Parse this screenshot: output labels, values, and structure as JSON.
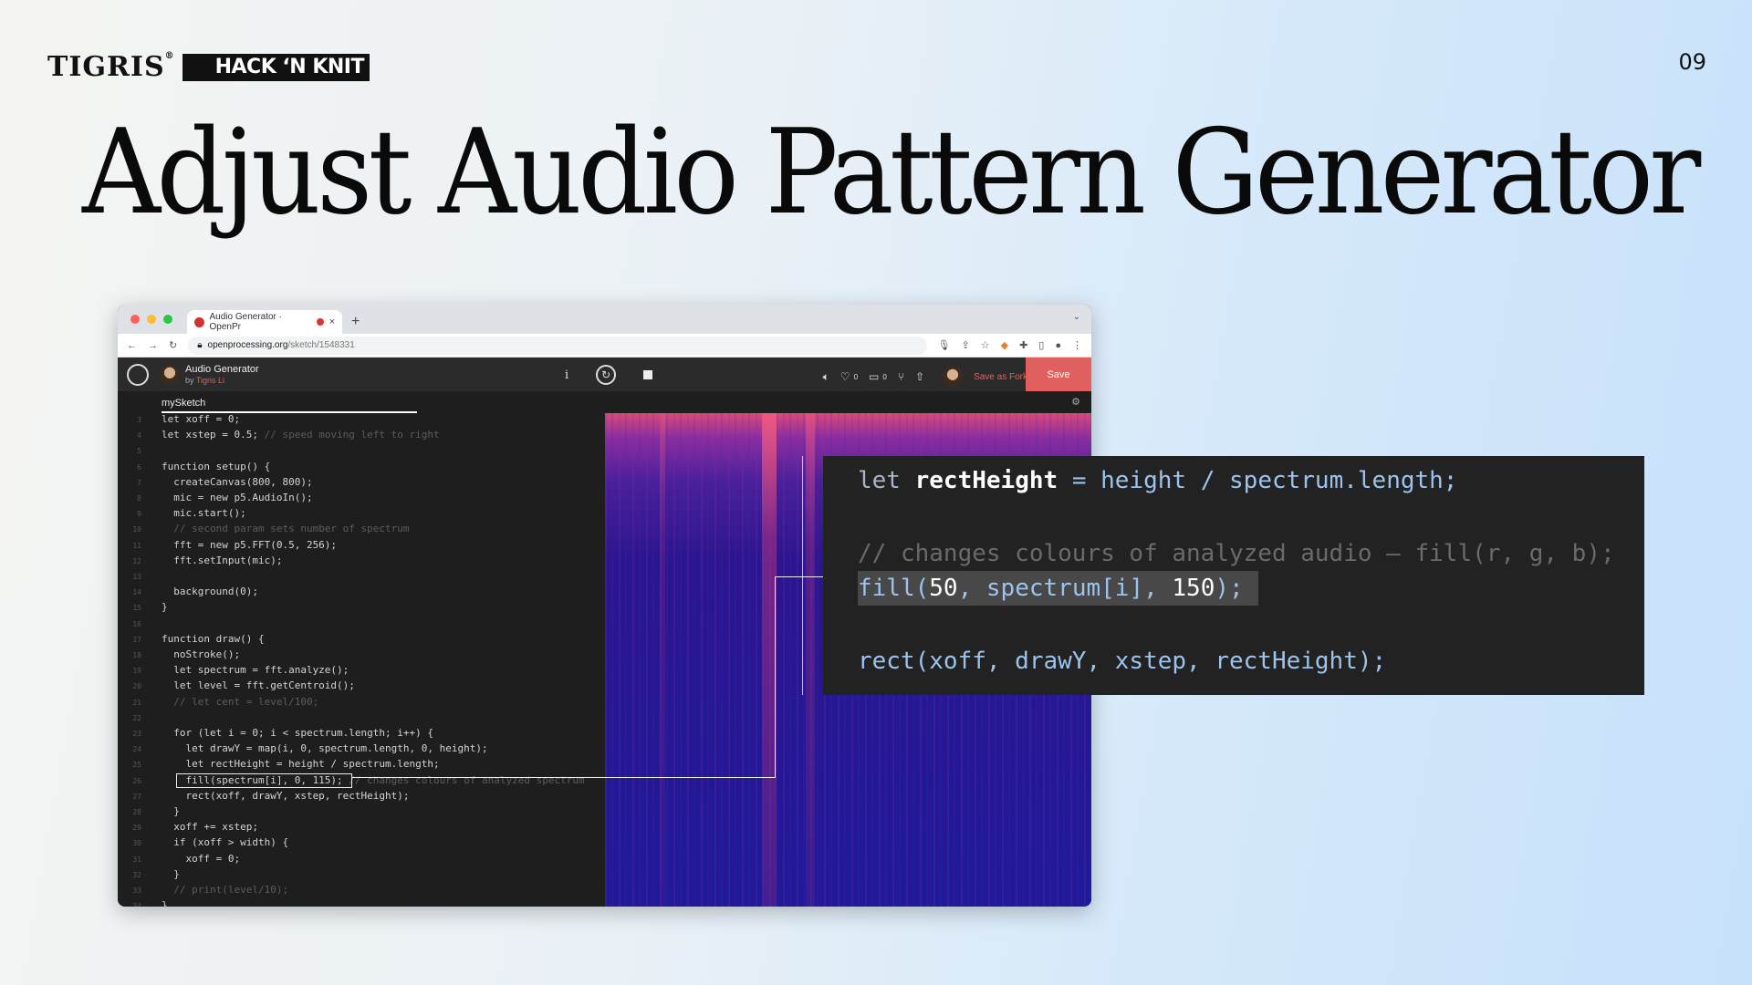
{
  "header": {
    "brand": "TIGRIS",
    "brand_mark": "®",
    "event": "HACK ‘N KNIT",
    "page_number": "09",
    "title": "Adjust Audio Pattern Generator"
  },
  "browser": {
    "tab_title": "Audio Generator · OpenPr",
    "tab_close": "×",
    "new_tab": "+",
    "url_domain": "openprocessing.org",
    "url_path": "/sketch/1548331",
    "sketch_title": "Audio Generator",
    "by_prefix": "by",
    "author": "Tigris Li",
    "likes": "0",
    "comments": "0",
    "save_fork_label": "Save as Fork",
    "save_label": "Save",
    "file_tab": "mySketch"
  },
  "code": [
    {
      "n": "3",
      "t": "let xoff = 0;",
      "c": ""
    },
    {
      "n": "4",
      "t": "let xstep = 0.5; ",
      "c": "// speed moving left to right"
    },
    {
      "n": "5",
      "t": "",
      "c": ""
    },
    {
      "n": "6",
      "t": "function setup() {",
      "c": ""
    },
    {
      "n": "7",
      "t": "  createCanvas(800, 800);",
      "c": ""
    },
    {
      "n": "8",
      "t": "  mic = new p5.AudioIn();",
      "c": ""
    },
    {
      "n": "9",
      "t": "  mic.start();",
      "c": ""
    },
    {
      "n": "10",
      "t": "  ",
      "c": "// second param sets number of spectrum"
    },
    {
      "n": "11",
      "t": "  fft = new p5.FFT(0.5, 256);",
      "c": ""
    },
    {
      "n": "12",
      "t": "  fft.setInput(mic);",
      "c": ""
    },
    {
      "n": "13",
      "t": "",
      "c": ""
    },
    {
      "n": "14",
      "t": "  background(0);",
      "c": ""
    },
    {
      "n": "15",
      "t": "}",
      "c": ""
    },
    {
      "n": "16",
      "t": "",
      "c": ""
    },
    {
      "n": "17",
      "t": "function draw() {",
      "c": ""
    },
    {
      "n": "18",
      "t": "  noStroke();",
      "c": ""
    },
    {
      "n": "19",
      "t": "  let spectrum = fft.analyze();",
      "c": ""
    },
    {
      "n": "20",
      "t": "  let level = fft.getCentroid();",
      "c": ""
    },
    {
      "n": "21",
      "t": "  ",
      "c": "// let cent = level/100;"
    },
    {
      "n": "22",
      "t": "",
      "c": ""
    },
    {
      "n": "23",
      "t": "  for (let i = 0; i < spectrum.length; i++) {",
      "c": ""
    },
    {
      "n": "24",
      "t": "    let drawY = map(i, 0, spectrum.length, 0, height);",
      "c": ""
    },
    {
      "n": "25",
      "t": "    let rectHeight = height / spectrum.length;",
      "c": ""
    },
    {
      "n": "26",
      "t": "    fill(spectrum[i], 0, 115); ",
      "c": "// changes colours of analyzed spectrum"
    },
    {
      "n": "27",
      "t": "    rect(xoff, drawY, xstep, rectHeight);",
      "c": ""
    },
    {
      "n": "28",
      "t": "  }",
      "c": ""
    },
    {
      "n": "29",
      "t": "  xoff += xstep;",
      "c": ""
    },
    {
      "n": "30",
      "t": "  if (xoff > width) {",
      "c": ""
    },
    {
      "n": "31",
      "t": "    xoff = 0;",
      "c": ""
    },
    {
      "n": "32",
      "t": "  }",
      "c": ""
    },
    {
      "n": "33",
      "t": "  ",
      "c": "// print(level/10);"
    },
    {
      "n": "34",
      "t": "}",
      "c": ""
    }
  ],
  "zoom": {
    "line1_kw": "let ",
    "line1_var": "rectHeight",
    "line1_rest": " = height / spectrum.length;",
    "line2_comment": "// changes colours of analyzed audio — fill(r, g, b);",
    "line3_fn": "fill(",
    "line3_a": "50",
    "line3_mid": ", spectrum[i], ",
    "line3_b": "150",
    "line3_end": ");",
    "line4": "rect(xoff, drawY, xstep, rectHeight);"
  },
  "colors": {
    "accent": "#e06060",
    "editor_bg": "#1e1e1e",
    "viz_top": "#d84a78",
    "viz_bottom": "#1e1a9a"
  }
}
